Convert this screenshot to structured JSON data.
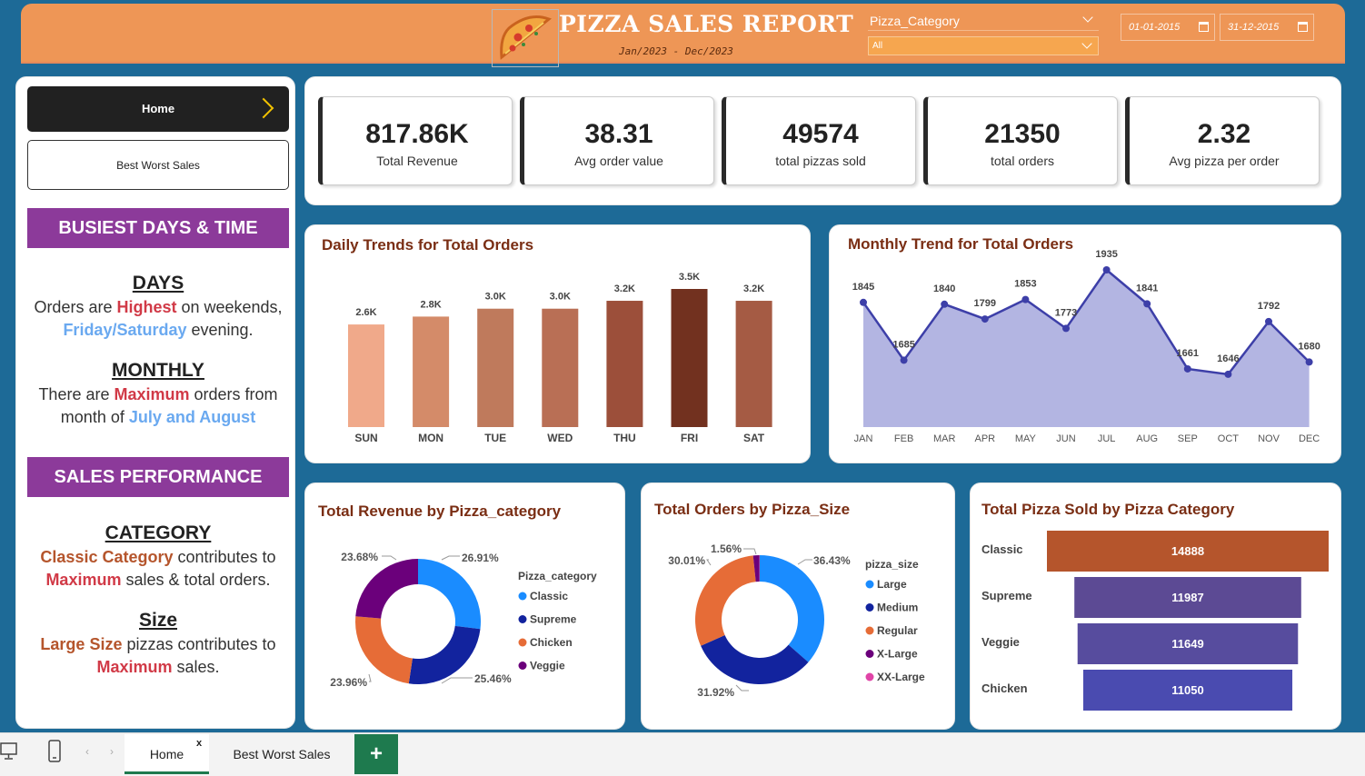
{
  "header": {
    "title": "PIZZA SALES REPORT",
    "subtitle": "Jan/2023 - Dec/2023",
    "slicer_label": "Pizza_Category",
    "slicer_value": "All",
    "date_from": "01-01-2015",
    "date_to": "31-12-2015",
    "colors": {
      "header_bg": "#ee9656",
      "page_bg": "#1d6a97"
    }
  },
  "nav": {
    "home_label": "Home",
    "best_worst_label": "Best Worst Sales"
  },
  "insights": {
    "busiest_banner": "BUSIEST DAYS & TIME",
    "days_head": "DAYS",
    "days_t1": "Orders are ",
    "days_hl1": "Highest",
    "days_t2": " on weekends,",
    "days_hl2": "Friday/Saturday",
    "days_t3": " evening.",
    "monthly_head": "MONTHLY",
    "monthly_t1": "There are ",
    "monthly_hl1": "Maximum",
    "monthly_t2": " orders from month of ",
    "monthly_hl2": "July and August",
    "sales_banner": "SALES PERFORMANCE",
    "category_head": "CATEGORY",
    "category_hl1": "Classic Category",
    "category_t1": " contributes to ",
    "category_hl2": "Maximum",
    "category_t2": " sales & total orders.",
    "size_head": "Size",
    "size_hl1": "Large Size",
    "size_t1": " pizzas contributes to ",
    "size_hl2": "Maximum",
    "size_t2": " sales."
  },
  "kpis": [
    {
      "value": "817.86K",
      "label": "Total Revenue"
    },
    {
      "value": "38.31",
      "label": "Avg order value"
    },
    {
      "value": "49574",
      "label": "total pizzas sold"
    },
    {
      "value": "21350",
      "label": "total orders"
    },
    {
      "value": "2.32",
      "label": "Avg pizza per order"
    }
  ],
  "charts": {
    "daily_title": "Daily Trends for Total Orders",
    "monthly_title": "Monthly Trend for Total Orders",
    "revenue_title": "Total Revenue by Pizza_category",
    "revenue_legend_title": "Pizza_category",
    "size_title": "Total Orders by Pizza_Size",
    "size_legend_title": "pizza_size",
    "funnel_title": "Total Pizza Sold by Pizza Category"
  },
  "chart_data": [
    {
      "type": "bar",
      "title": "Daily Trends for Total Orders",
      "categories": [
        "SUN",
        "MON",
        "TUE",
        "WED",
        "THU",
        "FRI",
        "SAT"
      ],
      "values": [
        2.6,
        2.8,
        3.0,
        3.0,
        3.2,
        3.5,
        3.2
      ],
      "labels": [
        "2.6K",
        "2.8K",
        "3.0K",
        "3.0K",
        "3.2K",
        "3.5K",
        "3.2K"
      ],
      "colors": [
        "#f0a98a",
        "#d48b69",
        "#bf7a5c",
        "#b96f55",
        "#9c4f3a",
        "#72311f",
        "#a55b44"
      ]
    },
    {
      "type": "area",
      "title": "Monthly Trend for Total Orders",
      "categories": [
        "JAN",
        "FEB",
        "MAR",
        "APR",
        "MAY",
        "JUN",
        "JUL",
        "AUG",
        "SEP",
        "OCT",
        "NOV",
        "DEC"
      ],
      "values": [
        1845,
        1685,
        1840,
        1799,
        1853,
        1773,
        1935,
        1841,
        1661,
        1646,
        1792,
        1680
      ],
      "colors": {
        "line": "#3d3fa8",
        "fill": "#b3b5e2"
      }
    },
    {
      "type": "pie",
      "title": "Total Revenue by Pizza_category",
      "legend_title": "Pizza_category",
      "categories": [
        "Classic",
        "Supreme",
        "Chicken",
        "Veggie"
      ],
      "values": [
        26.91,
        25.46,
        23.96,
        23.68
      ],
      "labels": [
        "26.91%",
        "25.46%",
        "23.96%",
        "23.68%"
      ],
      "colors": [
        "#1a8cff",
        "#12239e",
        "#e66c37",
        "#6b007b"
      ]
    },
    {
      "type": "pie",
      "title": "Total Orders by Pizza_Size",
      "legend_title": "pizza_size",
      "categories": [
        "Large",
        "Medium",
        "Regular",
        "X-Large",
        "XX-Large"
      ],
      "values": [
        36.43,
        31.92,
        30.01,
        1.56,
        0.08
      ],
      "labels": [
        "36.43%",
        "31.92%",
        "30.01%",
        "1.56%",
        ""
      ],
      "colors": [
        "#1a8cff",
        "#12239e",
        "#e66c37",
        "#6b007b",
        "#e044a7"
      ]
    },
    {
      "type": "bar",
      "title": "Total Pizza Sold by Pizza Category",
      "categories": [
        "Classic",
        "Supreme",
        "Veggie",
        "Chicken"
      ],
      "values": [
        14888,
        11987,
        11649,
        11050
      ],
      "colors": [
        "#b5552c",
        "#5c4a94",
        "#574c9e",
        "#4a4bb0"
      ]
    }
  ],
  "tabs": {
    "home": "Home",
    "best_worst": "Best Worst Sales",
    "add": "+",
    "close": "x"
  },
  "icons": {
    "pizza": "pizza-slice-icon",
    "calendar": "calendar-icon",
    "chevron": "chevron-down-icon",
    "arrow": "chevron-right-icon",
    "desktop": "desktop-icon",
    "phone": "phone-icon"
  }
}
